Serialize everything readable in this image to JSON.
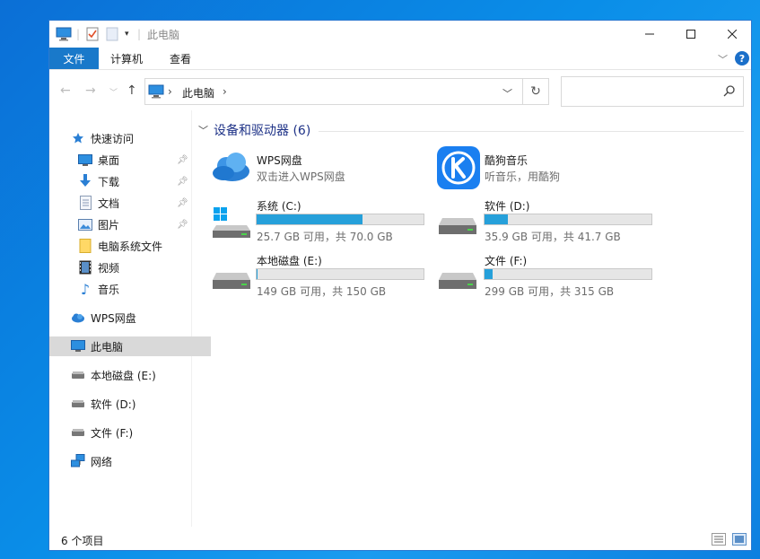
{
  "window": {
    "title": "此电脑"
  },
  "ribbon": {
    "tabs": [
      "文件",
      "计算机",
      "查看"
    ]
  },
  "address": {
    "path": [
      "此电脑"
    ],
    "search_placeholder": ""
  },
  "nav": {
    "quick_access": "快速访问",
    "pinned": [
      {
        "label": "桌面",
        "icon": "desktop-icon",
        "pinned": true
      },
      {
        "label": "下载",
        "icon": "download-icon",
        "pinned": true
      },
      {
        "label": "文档",
        "icon": "document-icon",
        "pinned": true
      },
      {
        "label": "图片",
        "icon": "picture-icon",
        "pinned": true
      },
      {
        "label": "电脑系统文件",
        "icon": "folder-icon",
        "pinned": false
      },
      {
        "label": "视频",
        "icon": "video-icon",
        "pinned": false
      },
      {
        "label": "音乐",
        "icon": "music-icon",
        "pinned": false
      }
    ],
    "wps": "WPS网盘",
    "this_pc": "此电脑",
    "drives": [
      "本地磁盘 (E:)",
      "软件 (D:)",
      "文件 (F:)"
    ],
    "network": "网络"
  },
  "content": {
    "group_title": "设备和驱动器 (6)",
    "apps": [
      {
        "name": "WPS网盘",
        "desc": "双击进入WPS网盘"
      },
      {
        "name": "酷狗音乐",
        "desc": "听音乐，用酷狗"
      }
    ],
    "drives": [
      {
        "name": "系统 (C:)",
        "free": "25.7 GB 可用，共 70.0 GB",
        "used_fraction": 0.633
      },
      {
        "name": "软件 (D:)",
        "free": "35.9 GB 可用，共 41.7 GB",
        "used_fraction": 0.139
      },
      {
        "name": "本地磁盘 (E:)",
        "free": "149 GB 可用，共 150 GB",
        "used_fraction": 0.007
      },
      {
        "name": "文件 (F:)",
        "free": "299 GB 可用，共 315 GB",
        "used_fraction": 0.051
      }
    ]
  },
  "status": {
    "count": "6 个项目"
  },
  "colors": {
    "accent": "#1979ca",
    "bar_fill": "#26a0da",
    "header_text": "#1e3287"
  }
}
